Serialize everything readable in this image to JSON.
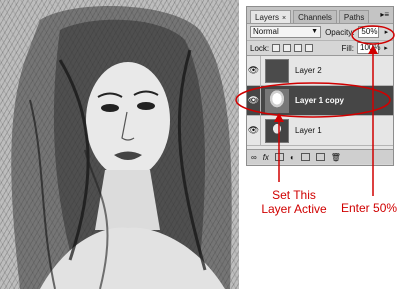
{
  "panel": {
    "tabs": [
      {
        "label": "Layers",
        "close": "×",
        "active": true
      },
      {
        "label": "Channels",
        "active": false
      },
      {
        "label": "Paths",
        "active": false
      }
    ],
    "menu_icon": "panel-menu-icon",
    "blend_mode": "Normal",
    "opacity_label": "Opacity:",
    "opacity_value": "50%",
    "lock_label": "Lock:",
    "fill_label": "Fill:",
    "fill_value": "100%",
    "layers": [
      {
        "name": "Layer 2",
        "thumb": "dark",
        "selected": false
      },
      {
        "name": "Layer 1 copy",
        "thumb": "sketch",
        "selected": true
      },
      {
        "name": "Layer 1",
        "thumb": "photo",
        "selected": false
      }
    ]
  },
  "annotations": {
    "set_active_line1": "Set This",
    "set_active_line2": "Layer Active",
    "enter_value": "Enter 50%"
  },
  "colors": {
    "annotation_red": "#d00000",
    "selected_layer_bg": "#464646",
    "panel_bg": "#d6d6d6"
  }
}
